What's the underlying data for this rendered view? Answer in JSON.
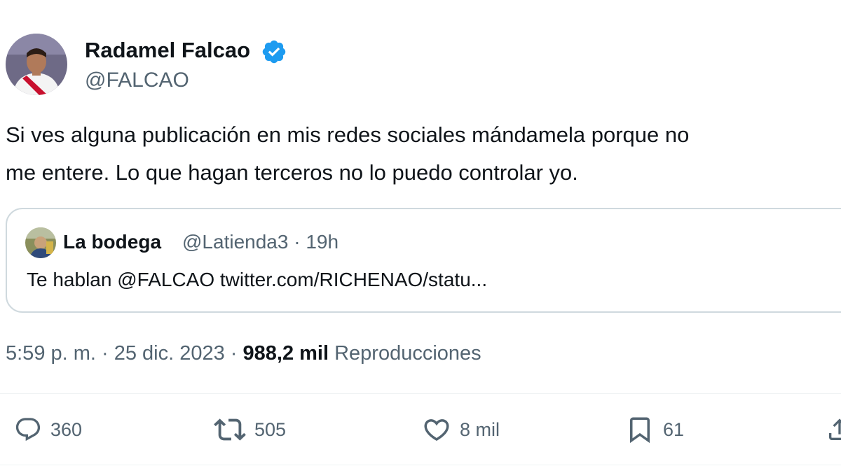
{
  "author": {
    "display_name": "Radamel Falcao",
    "handle": "@FALCAO",
    "verified": true
  },
  "tweet": {
    "lines": [
      "Si ves alguna publicación en mis redes sociales mándamela porque no",
      "me entere. Lo que hagan terceros no lo puedo controlar yo."
    ]
  },
  "quote": {
    "display_name": "La bodega",
    "meta": "@Latienda3 · 19h",
    "text": "Te hablan @FALCAO twitter.com/RICHENAO/statu..."
  },
  "meta_line": {
    "time": "5:59 p. m. · 25 dic. 2023 · ",
    "views_count": "988,2 mil",
    "views_label": " Reproducciones"
  },
  "actions": {
    "replies": "360",
    "reposts": "505",
    "likes": "8 mil",
    "bookmarks": "61"
  },
  "colors": {
    "text_primary": "#0f1419",
    "text_secondary": "#536471",
    "verified_blue": "#1d9bf0",
    "border": "#cfd9de"
  },
  "icons": [
    "verified-badge-icon",
    "reply-icon",
    "repost-icon",
    "like-icon",
    "bookmark-icon",
    "share-icon"
  ]
}
